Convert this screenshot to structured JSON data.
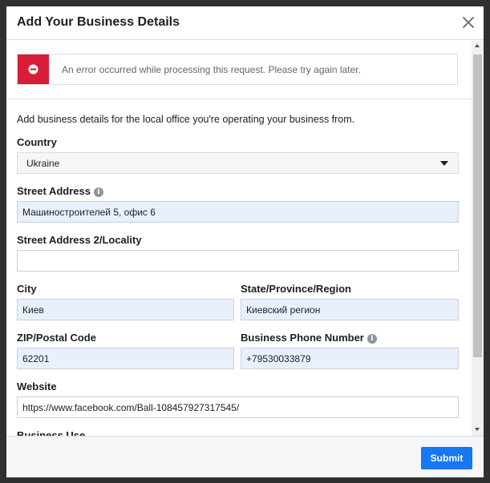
{
  "modal": {
    "title": "Add Your Business Details",
    "close_icon": "close-icon"
  },
  "error": {
    "icon": "error-minus-circle-icon",
    "message": "An error occurred while processing this request. Please try again later.",
    "color": "#d91c37"
  },
  "intro": "Add business details for the local office you're operating your business from.",
  "fields": {
    "country": {
      "label": "Country",
      "value": "Ukraine"
    },
    "street": {
      "label": "Street Address",
      "value": "Машиностроителей 5, офис 6",
      "info_icon": "info-icon"
    },
    "street2": {
      "label": "Street Address 2/Locality",
      "value": ""
    },
    "city": {
      "label": "City",
      "value": "Киев"
    },
    "state": {
      "label": "State/Province/Region",
      "value": "Киевский регион"
    },
    "zip": {
      "label": "ZIP/Postal Code",
      "value": "62201"
    },
    "phone": {
      "label": "Business Phone Number",
      "value": "+79530033879",
      "info_icon": "info-icon"
    },
    "website": {
      "label": "Website",
      "value": "https://www.facebook.com/Ball-108457927317545/"
    },
    "business_use": {
      "label": "Business Use"
    }
  },
  "footer": {
    "submit_label": "Submit",
    "accent": "#1877f2"
  }
}
